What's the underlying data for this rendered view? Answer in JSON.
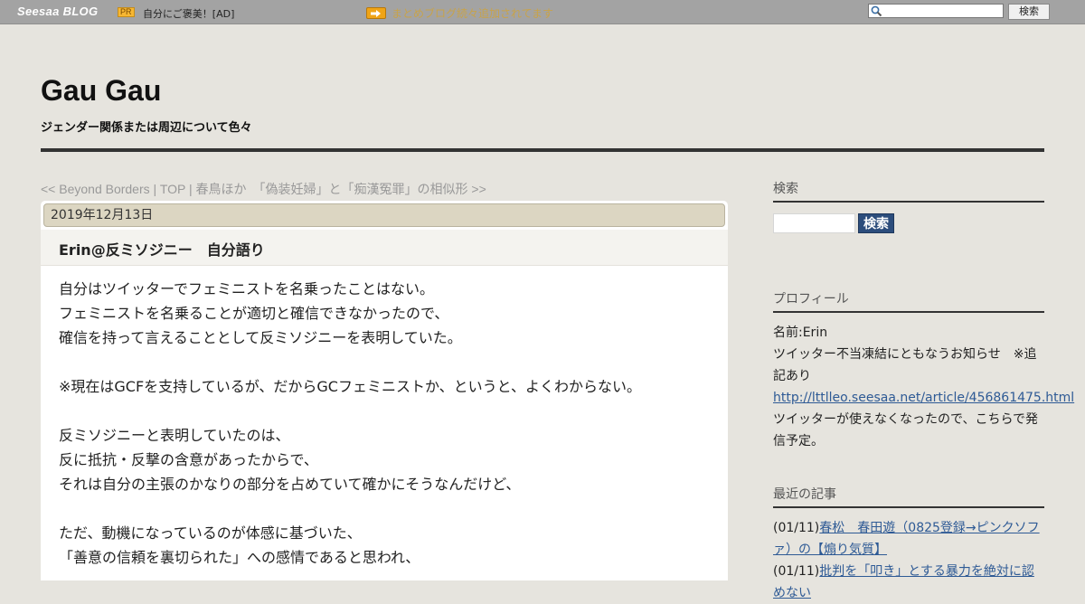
{
  "topbar": {
    "logo_main": "Seesaa",
    "logo_blog": "BLOG",
    "pr_badge": "PR",
    "ad_text": "自分にご褒美！[AD]",
    "notice": "まとめブログ続々追加されてます",
    "search_button": "検索"
  },
  "header": {
    "title": "Gau Gau",
    "description": "ジェンダー関係または周辺について色々"
  },
  "nav": {
    "prev": "<< Beyond Borders",
    "sep1": " | ",
    "top": "TOP",
    "sep2": " | ",
    "next": "春鳥ほか　「偽装妊婦」と「痴漢冤罪」の相似形 >>"
  },
  "article": {
    "date": "2019年12月13日",
    "title": "Erin@反ミソジニー　自分語り",
    "lines": [
      "自分はツイッターでフェミニストを名乗ったことはない。",
      "フェミニストを名乗ることが適切と確信できなかったので、",
      "確信を持って言えることとして反ミソジニーを表明していた。",
      "",
      "※現在はGCFを支持しているが、だからGCフェミニストか、というと、よくわからない。",
      "",
      "反ミソジニーと表明していたのは、",
      "反に抵抗・反撃の含意があったからで、",
      "それは自分の主張のかなりの部分を占めていて確かにそうなんだけど、",
      "",
      "ただ、動機になっているのが体感に基づいた、",
      "「善意の信頼を裏切られた」への感情であると思われ、"
    ]
  },
  "sidebar": {
    "search_heading": "検索",
    "search_button": "検索",
    "profile_heading": "プロフィール",
    "profile_name": "名前:Erin",
    "profile_note": "ツイッター不当凍結にともなうお知らせ　※追記あり",
    "profile_link": "http://lttlleo.seesaa.net/article/456861475.html",
    "profile_tail": "ツイッターが使えなくなったので、こちらで発信予定。",
    "recent_heading": "最近の記事",
    "recent": [
      {
        "date": "(01/11)",
        "title": "春松　春田遊（0825登録→ピンクソファ）の【煽り気質】"
      },
      {
        "date": "(01/11)",
        "title": "批判を「叩き」とする暴力を絶対に認めない"
      }
    ]
  }
}
